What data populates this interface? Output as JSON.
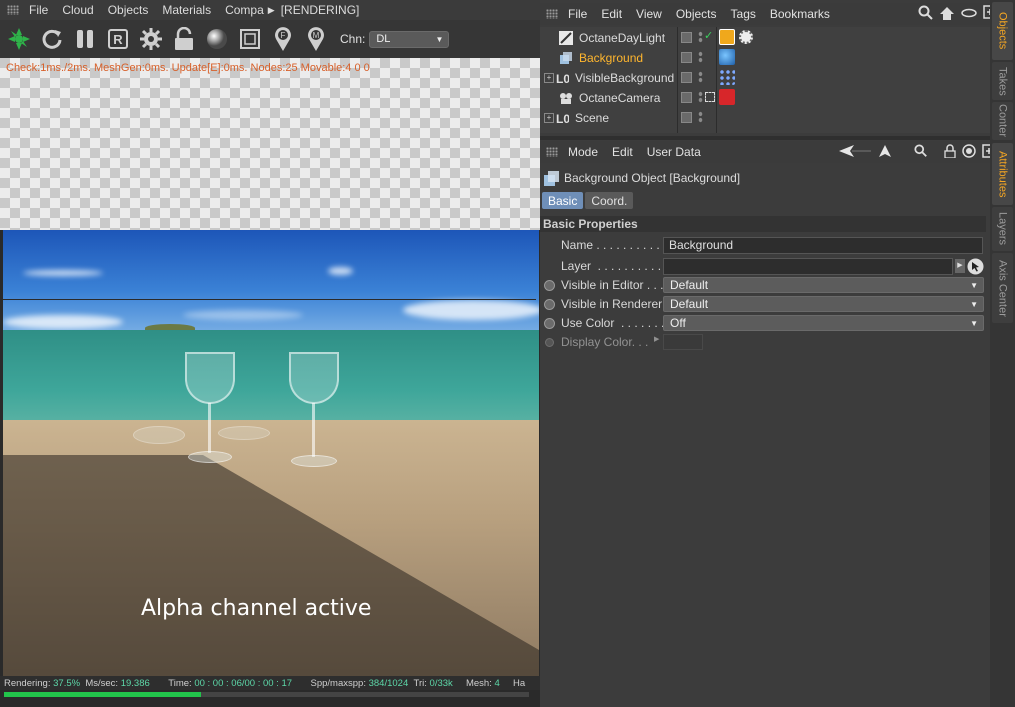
{
  "octane": {
    "menu": [
      "File",
      "Cloud",
      "Objects",
      "Materials",
      "Compa"
    ],
    "window_title": "[RENDERING]",
    "toolbar_icons": [
      "octane-logo-icon",
      "reload-icon",
      "pause-icon",
      "region-render-icon",
      "settings-gear-icon",
      "lock-icon",
      "sphere-material-icon",
      "frame-icon",
      "focus-picker-icon",
      "material-picker-icon"
    ],
    "channel_label": "Chn:",
    "channel_value": "DL",
    "stats": "Check:1ms./2ms. MeshGen:0ms. Update[E]:0ms. Nodes:25 Movable:4  0 0",
    "overlay_text": "Alpha channel active",
    "status": {
      "rendering_label": "Rendering:",
      "rendering_value": "37.5%",
      "mssec_label": "Ms/sec:",
      "mssec_value": "19.386",
      "time_label": "Time:",
      "time_value": "00 : 00 : 06/00 : 00 : 17",
      "spp_label": "Spp/maxspp:",
      "spp_value": "384/1024",
      "tri_label": "Tri:",
      "tri_value": "0/33k",
      "mesh_label": "Mesh:",
      "mesh_value": "4",
      "extra": "Ha"
    },
    "progress": 0.375
  },
  "objects_manager": {
    "menu": [
      "File",
      "Edit",
      "View",
      "Objects",
      "Tags",
      "Bookmarks"
    ],
    "items": [
      {
        "name": "OctaneDayLight",
        "selected": false,
        "expandable": false
      },
      {
        "name": "Background",
        "selected": true,
        "expandable": false
      },
      {
        "name": "VisibleBackground",
        "selected": false,
        "expandable": true
      },
      {
        "name": "OctaneCamera",
        "selected": false,
        "expandable": false
      },
      {
        "name": "Scene",
        "selected": false,
        "expandable": true
      }
    ]
  },
  "attributes": {
    "menu": [
      "Mode",
      "Edit",
      "User Data"
    ],
    "object_title": "Background Object [Background]",
    "tabs": [
      "Basic",
      "Coord."
    ],
    "section": "Basic Properties",
    "props": {
      "name_label": "Name . . . . . . . . . . .",
      "name_value": "Background",
      "layer_label": "Layer  . . . . . . . . . . .",
      "layer_value": "",
      "vis_editor_label": "Visible in Editor . . .",
      "vis_editor_value": "Default",
      "vis_renderer_label": "Visible in Renderer",
      "vis_renderer_value": "Default",
      "use_color_label": "Use Color  . . . . . . .",
      "use_color_value": "Off",
      "display_color_label": "Display Color. . ."
    }
  },
  "side_tabs": {
    "top": [
      "Objects",
      "Takes",
      "Conter"
    ],
    "bottom": [
      "Attributes",
      "Layers",
      "Axis Center"
    ]
  },
  "colors": {
    "accent": "#f5a623",
    "selected_text": "#ffb62e",
    "progress": "#22c44b",
    "stats_text": "#d7602a",
    "tab_on": "#6f8fb8"
  }
}
